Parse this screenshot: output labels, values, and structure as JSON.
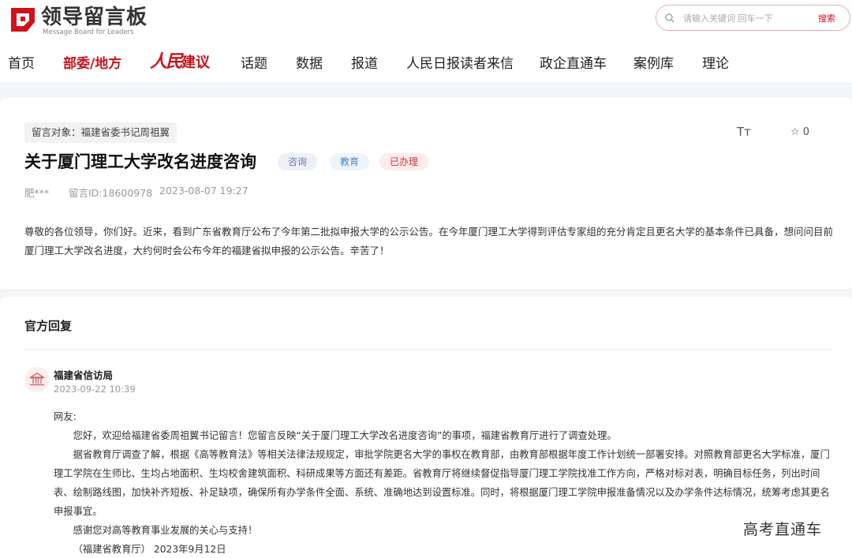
{
  "header": {
    "logo_cn": "领导留言板",
    "logo_en": "Message Board for Leaders",
    "search_placeholder": "请输入关键词 回车一下",
    "search_button": "搜索"
  },
  "nav": {
    "items": [
      "首页",
      "部委/地方",
      "话题",
      "数据",
      "报道",
      "人民日报读者来信",
      "政企直通车",
      "案例库",
      "理论"
    ],
    "brand_rm": "人民",
    "brand_jy": "建议",
    "active_index": 1
  },
  "message": {
    "target": "留言对象：福建省委书记周祖翼",
    "font_toggle": "Tт",
    "star_icon": "star-icon",
    "star_count": "☆ 0",
    "title": "关于厦门理工大学改名进度咨询",
    "tags": [
      "咨询",
      "教育",
      "已办理"
    ],
    "author": "肥***",
    "message_id": "留言ID:18600978",
    "date": "2023-08-07 19:27",
    "content": "尊敬的各位领导，你们好。近来，看到广东省教育厅公布了今年第二批拟申报大学的公示公告。在今年厦门理工大学得到评估专家组的充分肯定且更名大学的基本条件已具备，想问问目前厦门理工大学改名进度，大约何时会公布今年的福建省拟申报的公示公告。辛苦了！"
  },
  "reply": {
    "heading": "官方回复",
    "org": "福建省信访局",
    "time": "2023-09-22 10:39",
    "greeting": "网友:",
    "p1": "您好，欢迎给福建省委周祖翼书记留言！您留言反映“关于厦门理工大学改名进度咨询”的事项，福建省教育厅进行了调查处理。",
    "p2": "据省教育厅调查了解，根据《高等教育法》等相关法律法规规定，审批学院更名大学的事权在教育部，由教育部根据年度工作计划统一部署安排。对照教育部更名大学标准，厦门理工学院在生师比、生均占地面积、生均校舍建筑面积、科研成果等方面还有差距。省教育厅将继续督促指导厦门理工学院找准工作方向，严格对标对表，明确目标任务，列出时间表、绘制路线图，加快补齐短板、补足缺项，确保所有办学条件全面、系统、准确地达到设置标准。同时，将根据厦门理工学院申报准备情况以及办学条件达标情况，统筹考虑其更名申报事宜。",
    "p3": "感谢您对高等教育事业发展的关心与支持！",
    "sign": "（福建省教育厅） 2023年9月12日"
  },
  "watermark": "高考直通车",
  "colors": {
    "brand_red": "#c4161c",
    "accent_pink": "#e8aeb0"
  }
}
